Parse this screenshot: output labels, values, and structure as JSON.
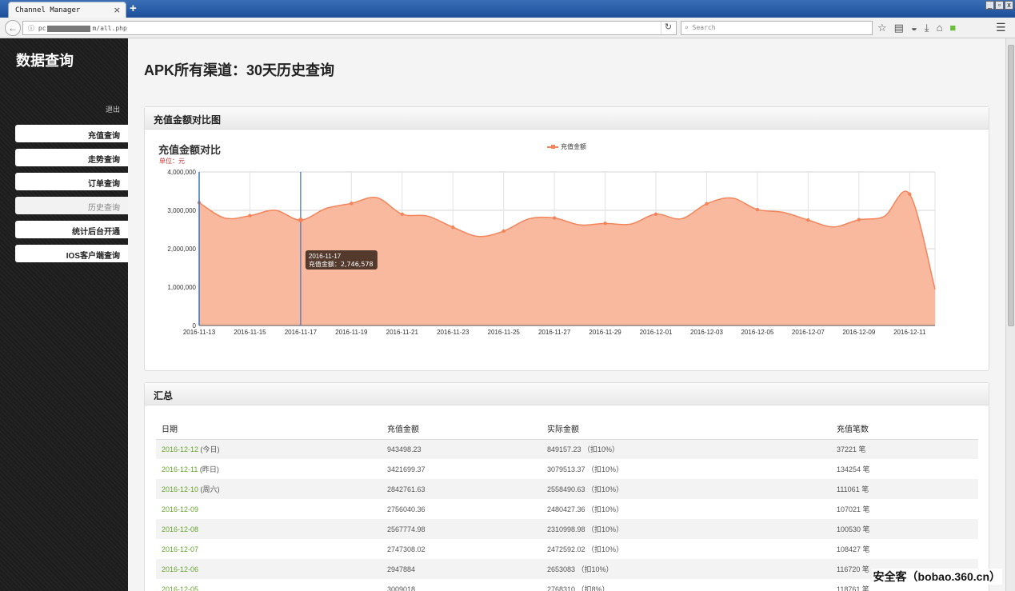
{
  "browser": {
    "tab_title": "Channel Manager",
    "tab_close": "×",
    "new_tab": "+",
    "url_prefix": "pc",
    "url_suffix": "m/all.php",
    "search_placeholder": "Search"
  },
  "sidebar": {
    "title": "数据查询",
    "logout": "退出",
    "items": [
      {
        "label": "充值查询",
        "disabled": false
      },
      {
        "label": "走势查询",
        "disabled": false
      },
      {
        "label": "订单查询",
        "disabled": false
      },
      {
        "label": "历史查询",
        "disabled": true
      },
      {
        "label": "统计后台开通",
        "disabled": false
      },
      {
        "label": "IOS客户端查询",
        "disabled": false
      }
    ]
  },
  "page": {
    "title": "APK所有渠道：30天历史查询"
  },
  "chart_panel": {
    "heading": "充值金额对比图",
    "chart_title": "充值金额对比",
    "unit": "单位：元",
    "legend": "充值金额",
    "tooltip_date": "2016-11-17",
    "tooltip_value": "充值金额：2,746,578"
  },
  "chart_data": {
    "type": "area",
    "title": "充值金额对比",
    "subtitle": "单位：元",
    "series": [
      {
        "name": "充值金额",
        "color": "#f4855b"
      }
    ],
    "x": [
      "2016-11-13",
      "2016-11-14",
      "2016-11-15",
      "2016-11-16",
      "2016-11-17",
      "2016-11-18",
      "2016-11-19",
      "2016-11-20",
      "2016-11-21",
      "2016-11-22",
      "2016-11-23",
      "2016-11-24",
      "2016-11-25",
      "2016-11-26",
      "2016-11-27",
      "2016-11-28",
      "2016-11-29",
      "2016-11-30",
      "2016-12-01",
      "2016-12-02",
      "2016-12-03",
      "2016-12-04",
      "2016-12-05",
      "2016-12-06",
      "2016-12-07",
      "2016-12-08",
      "2016-12-09",
      "2016-12-10",
      "2016-12-11",
      "2016-12-12"
    ],
    "values": [
      3200000,
      2800000,
      2860000,
      3000000,
      2746578,
      3050000,
      3180000,
      3330000,
      2900000,
      2850000,
      2560000,
      2320000,
      2460000,
      2780000,
      2800000,
      2620000,
      2660000,
      2640000,
      2900000,
      2780000,
      3170000,
      3320000,
      3020000,
      2950000,
      2747308,
      2567775,
      2756040,
      2842762,
      3421699,
      943498
    ],
    "tick_labels": [
      "2016-11-13",
      "2016-11-15",
      "2016-11-17",
      "2016-11-19",
      "2016-11-21",
      "2016-11-23",
      "2016-11-25",
      "2016-11-27",
      "2016-11-29",
      "2016-12-01",
      "2016-12-03",
      "2016-12-05",
      "2016-12-07",
      "2016-12-09",
      "2016-12-11"
    ],
    "y_ticks": [
      {
        "v": 0,
        "label": "0"
      },
      {
        "v": 1000000,
        "label": "1,000,000"
      },
      {
        "v": 2000000,
        "label": "2,000,000"
      },
      {
        "v": 3000000,
        "label": "3,000,000"
      },
      {
        "v": 4000000,
        "label": "4,000,000"
      }
    ],
    "ylim": [
      0,
      4000000
    ],
    "highlight_index": 4,
    "grid": true
  },
  "summary_panel": {
    "heading": "汇总",
    "columns": [
      "日期",
      "充值金额",
      "实际金额",
      "充值笔数"
    ],
    "rows": [
      {
        "date": "2016-12-12",
        "note": " (今日)",
        "amount": "943498.23",
        "actual": "849157.23 （扣10%）",
        "count": "37221 笔"
      },
      {
        "date": "2016-12-11",
        "note": " (昨日)",
        "amount": "3421699.37",
        "actual": "3079513.37 （扣10%）",
        "count": "134254 笔"
      },
      {
        "date": "2016-12-10",
        "note": " (周六)",
        "amount": "2842761.63",
        "actual": "2558490.63 （扣10%）",
        "count": "111061 笔"
      },
      {
        "date": "2016-12-09",
        "note": "",
        "amount": "2756040.36",
        "actual": "2480427.36 （扣10%）",
        "count": "107021 笔"
      },
      {
        "date": "2016-12-08",
        "note": "",
        "amount": "2567774.98",
        "actual": "2310998.98 （扣10%）",
        "count": "100530 笔"
      },
      {
        "date": "2016-12-07",
        "note": "",
        "amount": "2747308.02",
        "actual": "2472592.02 （扣10%）",
        "count": "108427 笔"
      },
      {
        "date": "2016-12-06",
        "note": "",
        "amount": "2947884",
        "actual": "2653083 （扣10%）",
        "count": "116720 笔"
      },
      {
        "date": "2016-12-05",
        "note": "",
        "amount": "3009018",
        "actual": "2768310 （扣8%）",
        "count": "118761 笔"
      }
    ]
  },
  "watermark": "安全客（bobao.360.cn）"
}
